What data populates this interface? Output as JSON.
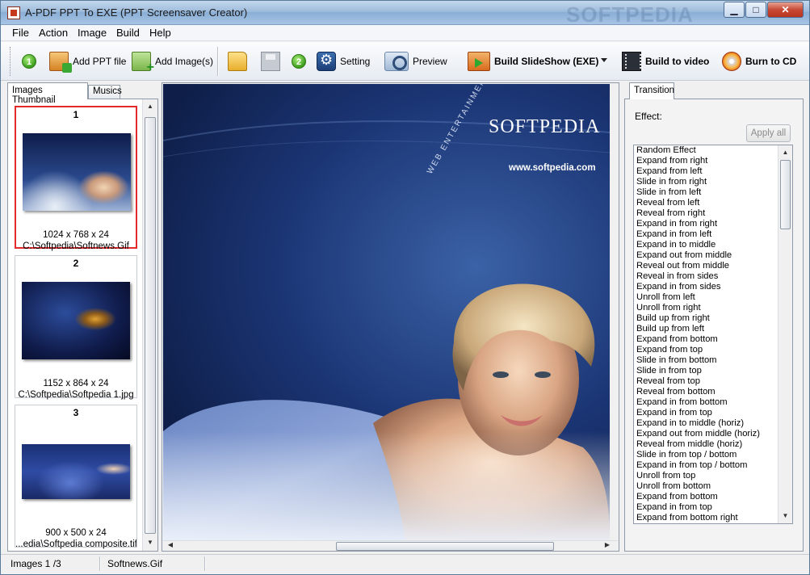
{
  "window": {
    "title": "A-PDF PPT To EXE (PPT Screensaver Creator)",
    "watermark": "SOFTPEDIA",
    "minimize_label": "▁",
    "maximize_label": "□",
    "close_label": "✕"
  },
  "menu": [
    "File",
    "Action",
    "Image",
    "Build",
    "Help"
  ],
  "toolbar": {
    "step1": "1",
    "add_ppt": "Add PPT file",
    "add_image": "Add Image(s)",
    "step2": "2",
    "setting": "Setting",
    "preview": "Preview",
    "build_slideshow": "Build SlideShow (EXE)",
    "build_video": "Build to video",
    "burn_cd": "Burn to CD",
    "icons": [
      "add-ppt-icon",
      "add-image-icon",
      "open-folder-icon",
      "save-icon",
      "gear-icon",
      "preview-icon",
      "build-icon",
      "film-icon",
      "cd-burn-icon"
    ]
  },
  "left_panel": {
    "tabs": [
      "Images Thumbnail",
      "Musics"
    ],
    "thumbnails": [
      {
        "num": "1",
        "dims": "1024 x 768 x 24",
        "path": "C:\\Softpedia\\Softnews.Gif"
      },
      {
        "num": "2",
        "dims": "1152 x 864 x 24",
        "path": "C:\\Softpedia\\Softpedia 1.jpg"
      },
      {
        "num": "3",
        "dims": "900 x 500 x 24",
        "path": "...edia\\Softpedia composite.tif"
      }
    ]
  },
  "preview": {
    "brand": "SOFTPEDIA",
    "url": "www.softpedia.com",
    "tagline": "WEB ENTERTAINMENT"
  },
  "right_panel": {
    "tab": "Transition",
    "effect_label": "Effect:",
    "apply_all": "Apply all",
    "effects": [
      "Random Effect",
      "Expand from right",
      "Expand from left",
      "Slide in from right",
      "Slide in from left",
      "Reveal from left",
      "Reveal from right",
      "Expand in from right",
      "Expand in from left",
      "Expand in to middle",
      "Expand out from middle",
      "Reveal out from middle",
      "Reveal in from sides",
      "Expand in from sides",
      "Unroll from left",
      "Unroll from right",
      "Build up from right",
      "Build up from left",
      "Expand from bottom",
      "Expand from top",
      "Slide in from bottom",
      "Slide in from top",
      "Reveal from top",
      "Reveal from bottom",
      "Expand in from bottom",
      "Expand in from top",
      "Expand in to middle (horiz)",
      "Expand out from middle (horiz)",
      "Reveal from middle (horiz)",
      "Slide in from top / bottom",
      "Expand in from top / bottom",
      "Unroll from top",
      "Unroll from bottom",
      "Expand from bottom",
      "Expand in from top",
      "Expand from bottom right"
    ]
  },
  "status": {
    "images": "Images 1 /3",
    "file": "Softnews.Gif"
  },
  "colors": {
    "selection_border": "#e22a2a",
    "preview_bg": "#1b3574"
  }
}
